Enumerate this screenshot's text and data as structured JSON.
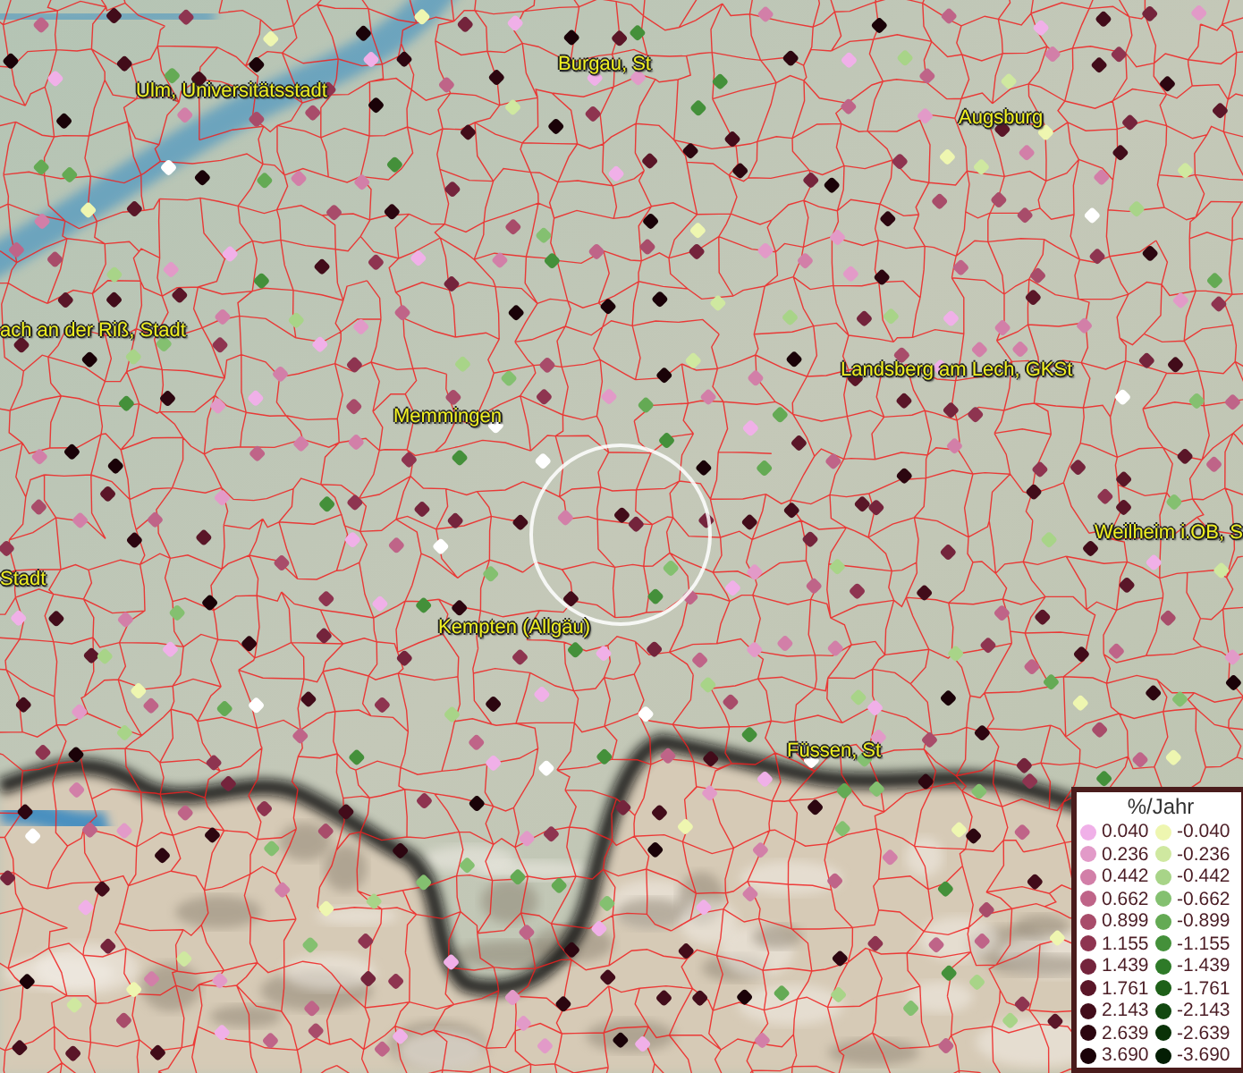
{
  "map": {
    "places": [
      {
        "name": "Ulm, Universitätsstadt"
      },
      {
        "name": "Burgau, St"
      },
      {
        "name": "Augsburg"
      },
      {
        "name": "ach an der Riß, Stadt"
      },
      {
        "name": "Landsberg am Lech, GKSt"
      },
      {
        "name": "Memmingen"
      },
      {
        "name": "Weilheim i.OB, S"
      },
      {
        "name": "Stadt"
      },
      {
        "name": "Kempten (Allgäu)"
      },
      {
        "name": "Füssen, St"
      }
    ]
  },
  "legend": {
    "title": "%/Jahr",
    "positive": [
      {
        "value": "0.040",
        "color": "#f0b0e8"
      },
      {
        "value": "0.236",
        "color": "#e29ac8"
      },
      {
        "value": "0.442",
        "color": "#d27fa8"
      },
      {
        "value": "0.662",
        "color": "#bf6488"
      },
      {
        "value": "0.899",
        "color": "#a84c6a"
      },
      {
        "value": "1.155",
        "color": "#8e3450"
      },
      {
        "value": "1.439",
        "color": "#74243c"
      },
      {
        "value": "1.761",
        "color": "#5a1628"
      },
      {
        "value": "2.143",
        "color": "#420c1a"
      },
      {
        "value": "2.639",
        "color": "#2c0610"
      },
      {
        "value": "3.690",
        "color": "#1a0208"
      }
    ],
    "negative": [
      {
        "value": "-0.040",
        "color": "#eef6b0"
      },
      {
        "value": "-0.236",
        "color": "#cfe8a0"
      },
      {
        "value": "-0.442",
        "color": "#a8d488"
      },
      {
        "value": "-0.662",
        "color": "#84c070"
      },
      {
        "value": "-0.899",
        "color": "#64aa54"
      },
      {
        "value": "-1.155",
        "color": "#44903a"
      },
      {
        "value": "-1.439",
        "color": "#2e7a28"
      },
      {
        "value": "-1.761",
        "color": "#1e6018"
      },
      {
        "value": "-2.143",
        "color": "#124810"
      },
      {
        "value": "-2.639",
        "color": "#0a3208"
      },
      {
        "value": "-3.690",
        "color": "#041e04"
      }
    ]
  }
}
